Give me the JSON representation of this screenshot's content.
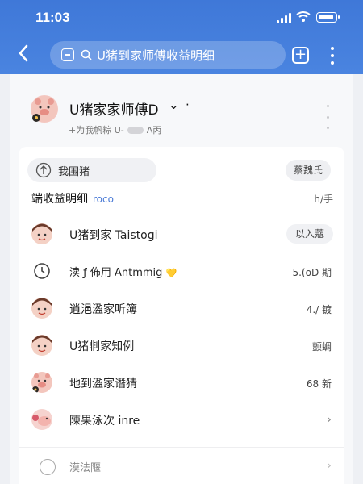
{
  "status_bar": {
    "time": "11:03"
  },
  "nav": {
    "back_icon": "chevron-left-icon",
    "search_text": "U猪到家师傅收益明细",
    "add_icon": "plus-square-icon",
    "more_icon": "more-vertical-icon"
  },
  "profile": {
    "name": "U猪家家师傅D",
    "chevron": "⌄",
    "dot": "·",
    "subtitle_left": "+为我帆粽 U-",
    "subtitle_right": "A丙"
  },
  "summary": {
    "left_label": "我围猪",
    "right_badge": "蔡魏氏"
  },
  "section": {
    "title": "端收益明细",
    "title_suffix": "roco",
    "right": "h/手"
  },
  "rows": [
    {
      "label": "U猪到家 Taistogi",
      "value": "以入蔻",
      "style": "button"
    },
    {
      "label": "渎 ƒ 佈用 Antmmig",
      "value": "5.(oD 期",
      "style": "text",
      "heart": "💛"
    },
    {
      "label": "逍浥溋家听簿",
      "value": "4./ 镀",
      "style": "text"
    },
    {
      "label": "U猪剕家知例",
      "value": "颤蜩",
      "style": "text"
    },
    {
      "label": "地到溋家谮猜",
      "value": "68 新",
      "style": "text"
    },
    {
      "label": "陳果泳次 inre",
      "value": "›",
      "style": "arrow"
    }
  ],
  "footer": {
    "label": "漠法隁",
    "arrow": "›"
  },
  "colors": {
    "header_blue": "#4580dc",
    "accent_blue": "#4a7ad6"
  }
}
